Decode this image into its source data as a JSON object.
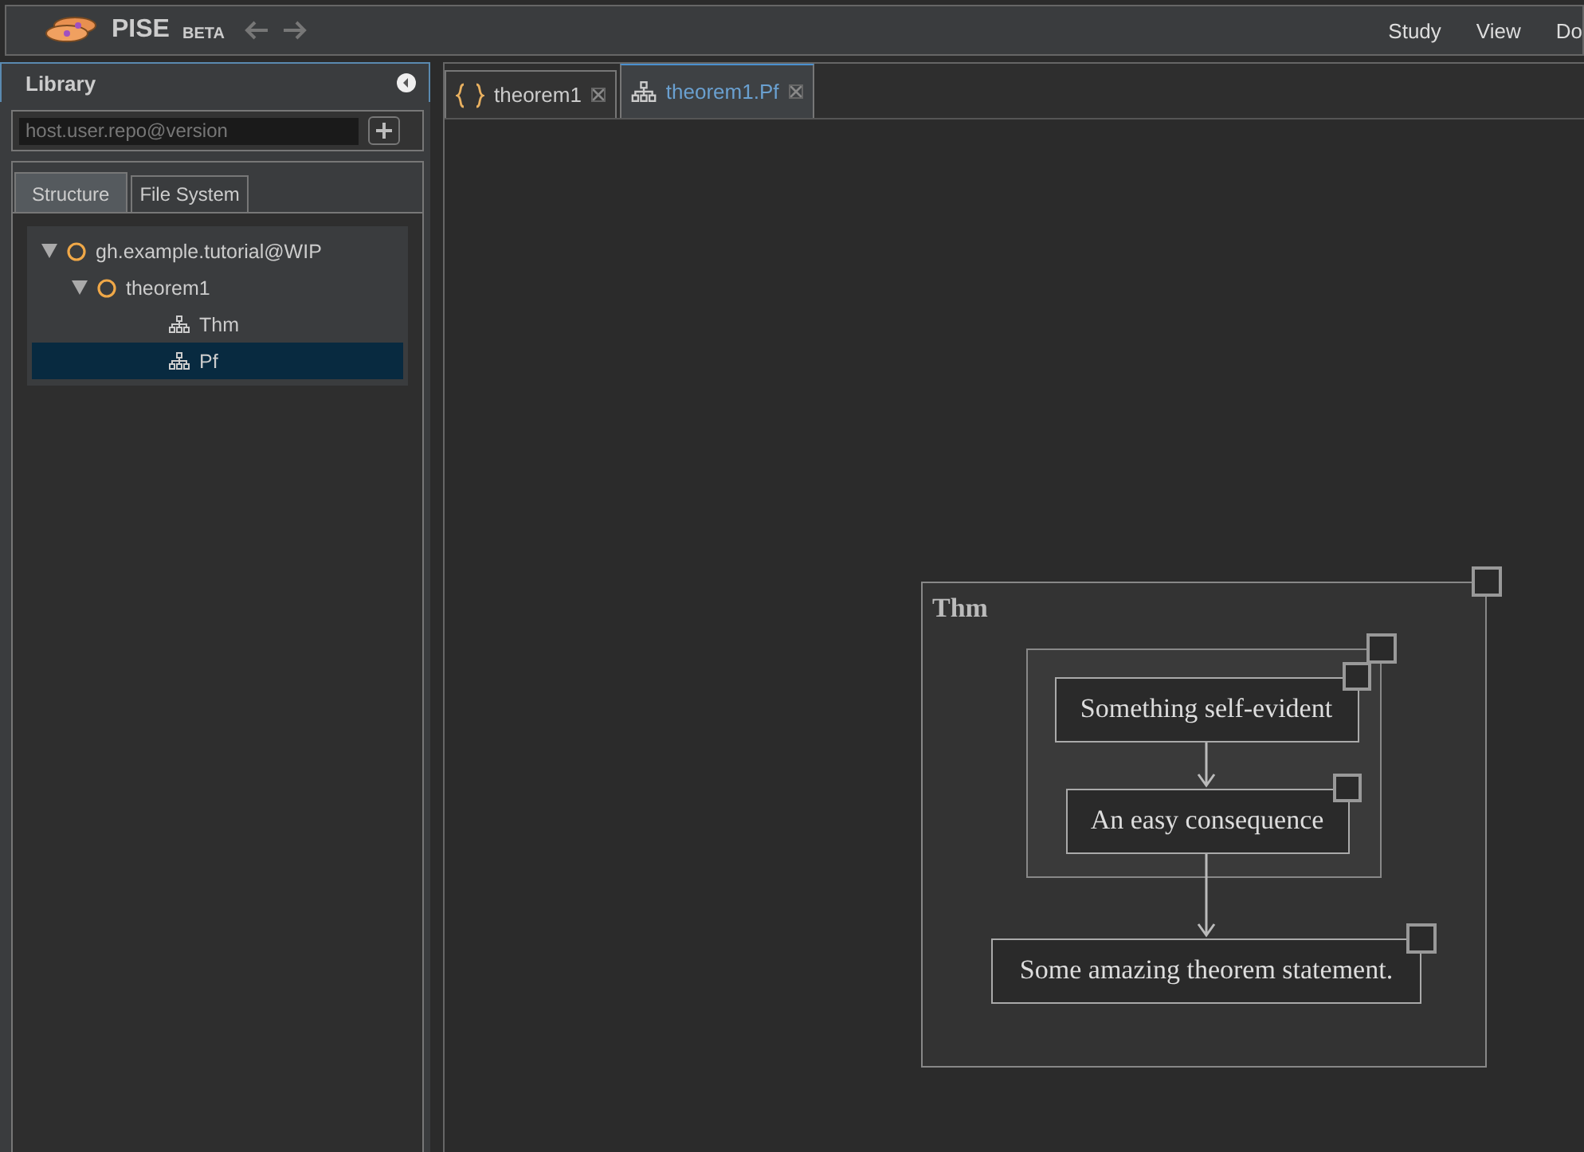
{
  "app": {
    "name": "PISE",
    "badge": "BETA"
  },
  "menu": [
    "Study",
    "View",
    "Do"
  ],
  "library": {
    "title": "Library",
    "search": {
      "placeholder": "host.user.repo@version"
    },
    "tabs": [
      {
        "label": "Structure",
        "selected": true
      },
      {
        "label": "File System",
        "selected": false
      }
    ],
    "tree": [
      {
        "label": "gh.example.tutorial@WIP",
        "kind": "repo",
        "expanded": true,
        "selected": false,
        "children": [
          {
            "label": "theorem1",
            "kind": "module",
            "expanded": true,
            "selected": false,
            "children": [
              {
                "label": "Thm",
                "kind": "graph",
                "selected": false
              },
              {
                "label": "Pf",
                "kind": "graph",
                "selected": true
              }
            ]
          }
        ]
      }
    ]
  },
  "editor_tabs": [
    {
      "label": "theorem1",
      "kind": "module",
      "selected": false
    },
    {
      "label": "theorem1.Pf",
      "kind": "graph",
      "selected": true
    }
  ],
  "diagram": {
    "label": "Thm",
    "group_nodes": [
      "Something self-evident",
      "An easy consequence"
    ],
    "conclusion": "Some amazing theorem statement."
  }
}
